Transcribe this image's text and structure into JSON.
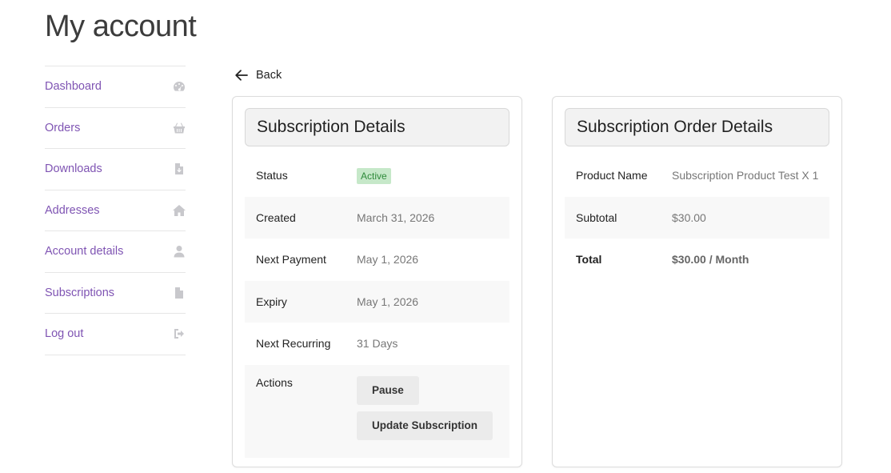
{
  "page": {
    "title": "My account"
  },
  "sidebar": {
    "items": [
      {
        "label": "Dashboard",
        "icon": "dashboard-icon"
      },
      {
        "label": "Orders",
        "icon": "basket-icon"
      },
      {
        "label": "Downloads",
        "icon": "file-download-icon"
      },
      {
        "label": "Addresses",
        "icon": "home-icon"
      },
      {
        "label": "Account details",
        "icon": "user-icon"
      },
      {
        "label": "Subscriptions",
        "icon": "file-text-icon"
      },
      {
        "label": "Log out",
        "icon": "sign-out-icon"
      }
    ],
    "colors": {
      "link": "#7f54b3",
      "icon": "#c8c8cc"
    }
  },
  "back": {
    "label": "Back",
    "icon": "arrow-left-icon"
  },
  "subscription_details": {
    "title": "Subscription Details",
    "status_label": "Status",
    "status_value": "Active",
    "created_label": "Created",
    "created_value": "March 31, 2026",
    "next_payment_label": "Next Payment",
    "next_payment_value": "May 1, 2026",
    "expiry_label": "Expiry",
    "expiry_value": "May 1, 2026",
    "next_recurring_label": "Next Recurring",
    "next_recurring_value": "31 Days",
    "actions_label": "Actions",
    "pause_button": "Pause",
    "update_button": "Update Subscription",
    "status_colors": {
      "background": "#c6e8c9",
      "text": "#2e8a3a"
    }
  },
  "order_details": {
    "title": "Subscription Order Details",
    "product_label": "Product Name",
    "product_value": "Subscription Product Test X 1",
    "subtotal_label": "Subtotal",
    "subtotal_value": "$30.00",
    "total_label": "Total",
    "total_value": "$30.00 / Month"
  }
}
